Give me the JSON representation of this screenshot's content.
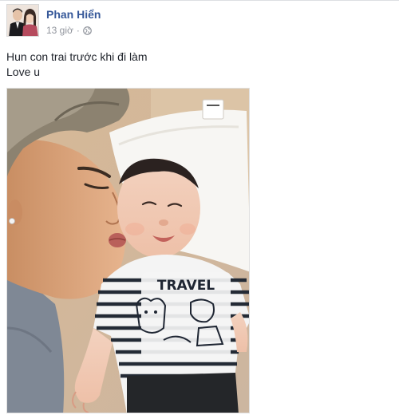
{
  "post": {
    "author": "Phan Hiển",
    "time": "13 giờ",
    "separator": "·",
    "privacy_icon": "globe-icon",
    "text_lines": [
      "Hun con trai trước khi đi làm",
      "Love u"
    ],
    "photo": {
      "shirt_text": "TRAVEL"
    }
  },
  "colors": {
    "author_link": "#365899",
    "meta_gray": "#90949c",
    "text": "#1d2129"
  }
}
